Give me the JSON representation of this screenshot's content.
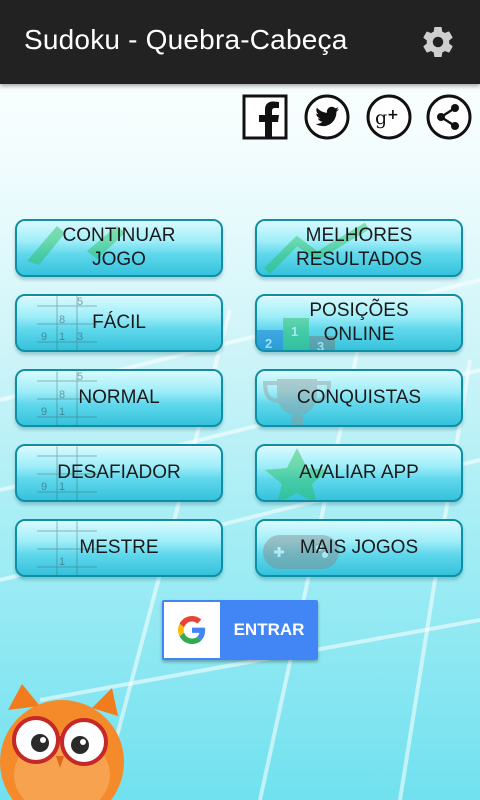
{
  "app_bar": {
    "title": "Sudoku - Quebra-Cabeça",
    "settings_icon": "gear-icon",
    "background": "#222222"
  },
  "social": [
    {
      "name": "facebook",
      "icon": "facebook-icon"
    },
    {
      "name": "twitter",
      "icon": "twitter-icon"
    },
    {
      "name": "google-plus",
      "icon": "google-plus-icon"
    },
    {
      "name": "share",
      "icon": "share-icon"
    }
  ],
  "menu": {
    "continue": "CONTINUAR\nJOGO",
    "best_results": "MELHORES\nRESULTADOS",
    "easy": "FÁCIL",
    "online_positions": "POSIÇÕES\nONLINE",
    "normal": "NORMAL",
    "achievements": "CONQUISTAS",
    "challenging": "DESAFIADOR",
    "rate_app": "AVALIAR APP",
    "master": "MESTRE",
    "more_games": "MAIS JOGOS"
  },
  "google_signin": {
    "label": "ENTRAR",
    "icon": "google-g-icon",
    "color": "#4285f4"
  },
  "ghost_digits": {
    "easy": [
      "5",
      "8",
      "9",
      "1",
      "3"
    ],
    "normal": [
      "5",
      "8",
      "9",
      "1"
    ],
    "challenging": [
      "9",
      "1"
    ],
    "master": [
      "1"
    ],
    "podium": [
      "2",
      "1",
      "3"
    ]
  },
  "mascot": "owl-mascot",
  "colors": {
    "button_top": "#d9fbff",
    "button_bottom": "#36c2dc",
    "button_border": "#0e8fa6",
    "background_bottom": "#71e1ef"
  }
}
